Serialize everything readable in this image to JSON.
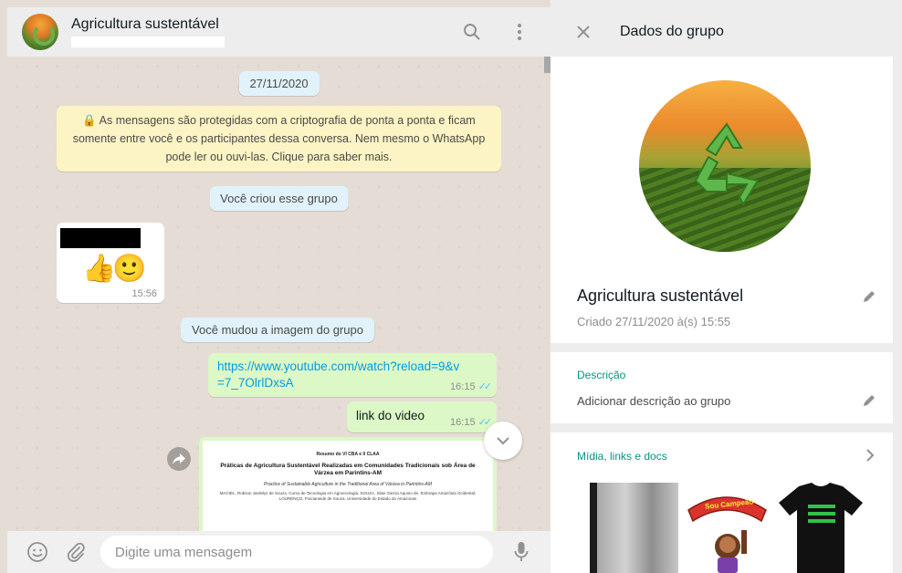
{
  "chat": {
    "title": "Agricultura sustentável",
    "date_pill": "27/11/2020",
    "encryption_notice": "As mensagens são protegidas com a criptografia de ponta a ponta e ficam somente entre você e os participantes dessa conversa. Nem mesmo o WhatsApp pode ler ou ouvi-las. Clique para saber mais.",
    "group_created": "Você criou esse grupo",
    "sticker_message": {
      "emoji": "👍🙂",
      "time": "15:56"
    },
    "group_image_changed": "Você mudou a imagem do grupo",
    "link_message": {
      "text": "https://www.youtube.com/watch?reload=9&v=7_7OlrlDxsA",
      "time": "16:15",
      "ticks": "✓✓"
    },
    "video_message": {
      "text": "link do video",
      "time": "16:15",
      "ticks": "✓✓"
    },
    "document_preview": {
      "header": "Resumo do VI CBA e II CLAA",
      "title": "Práticas de Agricultura Sustentável Realizadas em Comunidades Tradicionais sob Área de Várzea em Parintins-AM",
      "subtitle": "Practice of Sustainable Agriculture in the Traditional Area of Várzea in Parintins-AM",
      "authors": "MACIEL, Robson Jardelys de Souza. Curso de Tecnologia em Agroecologia; SOUZA, Silas Garcia Aquino de. Embrapa Amazônia Ocidental; LOURENÇO, Fracianeide de Souza. Universidade do Estado do Amazonas"
    },
    "composer": {
      "placeholder": "Digite uma mensagem"
    }
  },
  "info": {
    "header_title": "Dados do grupo",
    "group_name": "Agricultura sustentável",
    "created": "Criado 27/11/2020 à(s) 15:55",
    "description_label": "Descrição",
    "description_value": "Adicionar descrição ao grupo",
    "media_label": "Mídia, links e docs",
    "media_thumbs": [
      {
        "alt": "foto-cinza"
      },
      {
        "banner_text": "Sou Campeão"
      },
      {
        "alt": "camiseta-preta"
      }
    ]
  },
  "colors": {
    "header_bg": "#ededed",
    "chat_bg": "#e5ddd5",
    "outgoing_bubble": "#dcf8c6",
    "system_bubble": "#e1f2fb",
    "notice_bubble": "#fdf4c5",
    "accent_teal": "#009688",
    "link_blue": "#039be5"
  }
}
